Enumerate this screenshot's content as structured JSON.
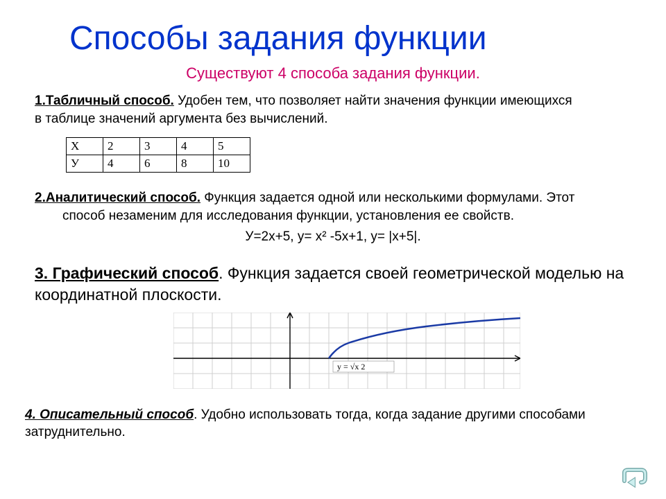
{
  "title": "Способы задания функции",
  "subtitle": "Существуют 4 способа задания функции.",
  "section1": {
    "label": "1.Табличный способ.",
    "text_a": " Удобен тем, что позволяет найти значения функции имеющихся",
    "text_b": "в таблице значений аргумента без вычислений."
  },
  "table": {
    "r0": [
      "X",
      "2",
      "3",
      "4",
      "5"
    ],
    "r1": [
      "У",
      "4",
      "6",
      "8",
      "10"
    ]
  },
  "section2": {
    "label": "2.Аналитический способ.",
    "text_a": " Функция задается одной или несколькими формулами. Этот",
    "text_b": "способ незаменим для исследования функции, установления ее свойств."
  },
  "formulas": "У=2x+5,    у= x² -5x+1,     у=  |x+5|.",
  "section3": {
    "label": "3. Графический способ",
    "text": ". Функция задается своей геометрической моделью на координатной плоскости."
  },
  "graph_label": "y = √x  2",
  "section4": {
    "label": " 4. Описательный способ",
    "text": ". Удобно использовать тогда, когда задание другими способами затруднительно."
  },
  "back_button": "back-button"
}
